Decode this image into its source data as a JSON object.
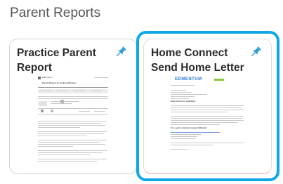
{
  "section": {
    "title": "Parent Reports"
  },
  "cards": [
    {
      "title": "Practice Parent Report",
      "pin_icon": "pin-icon",
      "thumbnail": {
        "brand": "Edmentum",
        "doc_title": "Parent Report for Andrea Martinez"
      }
    },
    {
      "title": "Home Connect Send Home Letter",
      "pin_icon": "pin-icon",
      "thumbnail": {
        "brand": "EDMENTUM",
        "doc_heading": "Dear Parent or Guardian,",
        "doc_subheading": "To Log In to Home Connect Website:"
      }
    }
  ],
  "colors": {
    "focus": "#0fa7e6",
    "pin": "#2f9bd6",
    "brand_blue": "#2c7ad6",
    "brand_green": "#8dc63f"
  }
}
